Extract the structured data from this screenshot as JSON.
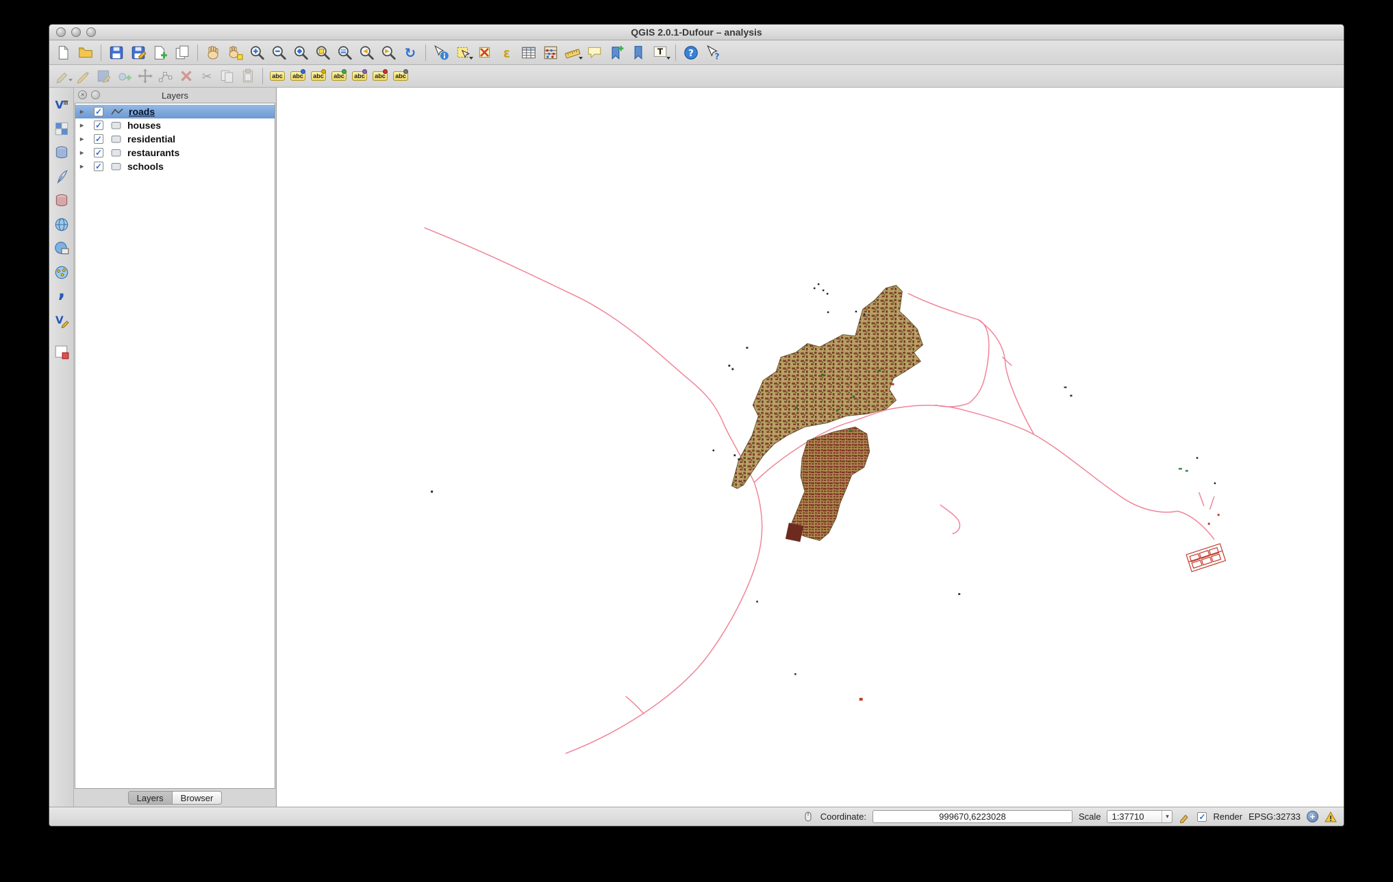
{
  "window": {
    "title": "QGIS 2.0.1-Dufour – analysis"
  },
  "layers_panel": {
    "title": "Layers",
    "items": [
      {
        "label": "roads",
        "checked": true,
        "selected": true
      },
      {
        "label": "houses",
        "checked": true,
        "selected": false
      },
      {
        "label": "residential",
        "checked": true,
        "selected": false
      },
      {
        "label": "restaurants",
        "checked": true,
        "selected": false
      },
      {
        "label": "schools",
        "checked": true,
        "selected": false
      }
    ],
    "tabs": {
      "layers": "Layers",
      "browser": "Browser"
    }
  },
  "status_bar": {
    "coordinate_label": "Coordinate:",
    "coordinate_value": "999670,6223028",
    "scale_label": "Scale",
    "scale_value": "1:37710",
    "render_label": "Render",
    "crs_label": "EPSG:32733"
  },
  "icons": {
    "check": "✓",
    "triangle": "▸",
    "close": "×",
    "epsilon": "ε",
    "tee": "T",
    "question": "?",
    "abc": "abc",
    "comma": ",",
    "scissors": "✂",
    "vee": "V",
    "refresh": "↻",
    "plus": "+",
    "dropdown": "▾"
  },
  "colors": {
    "road": "#f08498",
    "urban_fill": "#b7a264",
    "building": "#7b2f22",
    "selection_blue": "#6d9bd4"
  }
}
